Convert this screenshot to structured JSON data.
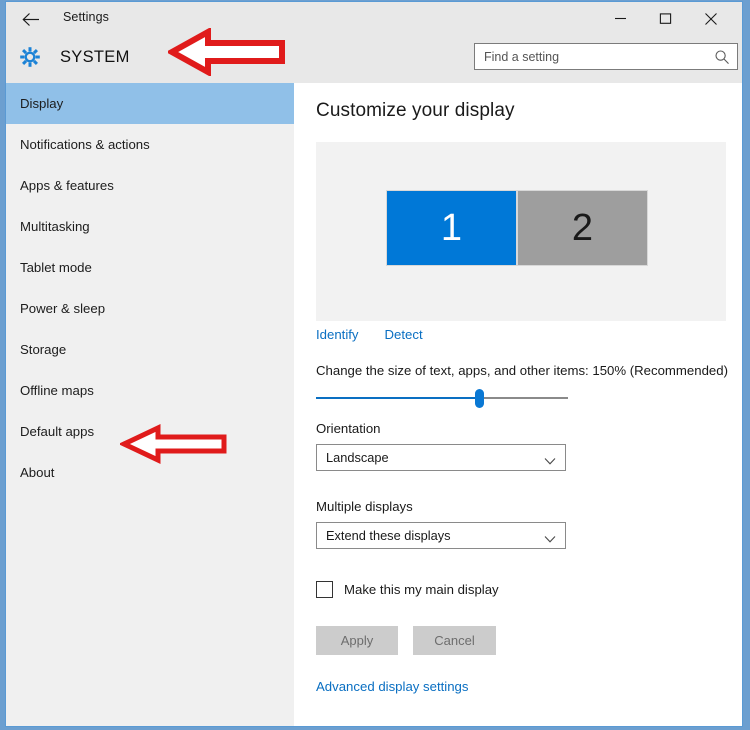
{
  "window": {
    "title": "Settings",
    "back_icon": "back-arrow-icon",
    "minimize_label": "—",
    "maximize_label": "□",
    "close_label": "✕"
  },
  "header": {
    "icon": "gear-icon",
    "title": "SYSTEM"
  },
  "search": {
    "placeholder": "Find a setting",
    "value": "",
    "icon": "search-icon"
  },
  "sidebar": {
    "items": [
      {
        "label": "Display",
        "selected": true
      },
      {
        "label": "Notifications & actions",
        "selected": false
      },
      {
        "label": "Apps & features",
        "selected": false
      },
      {
        "label": "Multitasking",
        "selected": false
      },
      {
        "label": "Tablet mode",
        "selected": false
      },
      {
        "label": "Power & sleep",
        "selected": false
      },
      {
        "label": "Storage",
        "selected": false
      },
      {
        "label": "Offline maps",
        "selected": false
      },
      {
        "label": "Default apps",
        "selected": false
      },
      {
        "label": "About",
        "selected": false
      }
    ]
  },
  "content": {
    "heading": "Customize your display",
    "monitors": [
      {
        "number": "1",
        "color": "#0078d7",
        "selected": true
      },
      {
        "number": "2",
        "color": "#9e9e9e",
        "selected": false
      }
    ],
    "identify_link": "Identify",
    "detect_link": "Detect",
    "scale": {
      "label": "Change the size of text, apps, and other items: 150% (Recommended)",
      "value_percent": "150%",
      "thumb_position_percent": 65
    },
    "orientation": {
      "label": "Orientation",
      "value": "Landscape",
      "arrow_icon": "chevron-down-icon"
    },
    "multiple_displays": {
      "label": "Multiple displays",
      "value": "Extend these displays",
      "arrow_icon": "chevron-down-icon"
    },
    "main_display_checkbox": {
      "label": "Make this my main display",
      "checked": false
    },
    "apply_button": "Apply",
    "cancel_button": "Cancel",
    "advanced_link": "Advanced display settings"
  },
  "annotations": {
    "arrow_color": "#e01b1b",
    "arrow_fill": "#ffffff",
    "items": [
      {
        "name": "arrow-pointing-to-system-header",
        "direction": "left"
      },
      {
        "name": "arrow-pointing-to-default-apps",
        "direction": "left"
      }
    ]
  }
}
